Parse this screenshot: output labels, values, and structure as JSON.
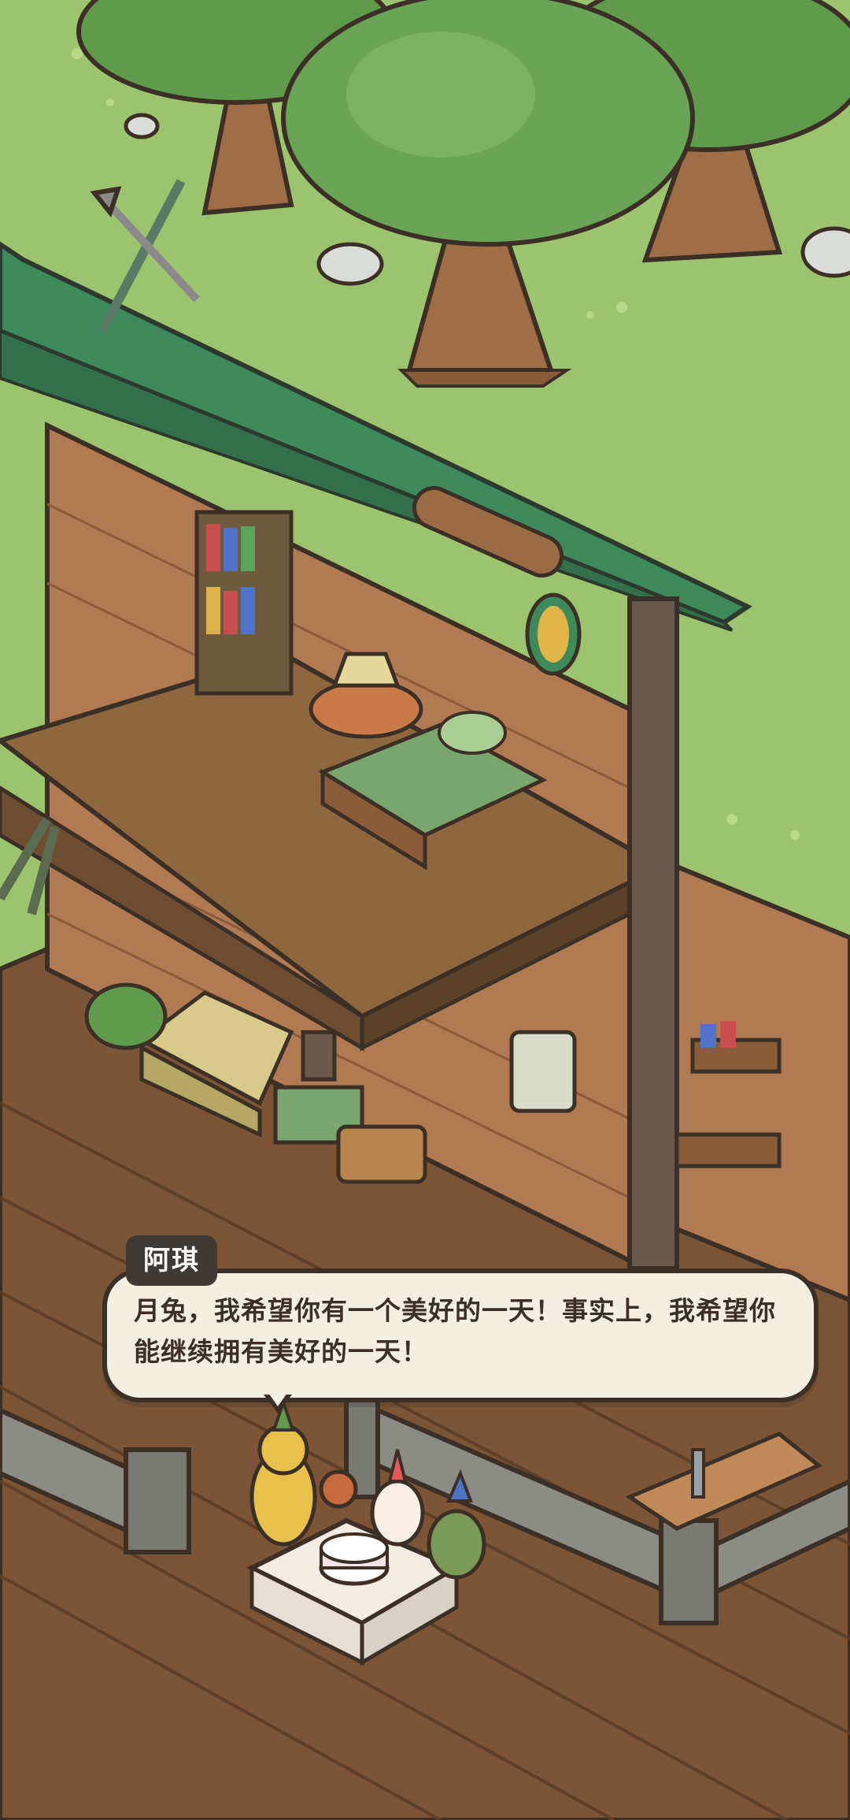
{
  "scene": {
    "description_icon": "treehouse-birthday-scene",
    "colors": {
      "grass": "#9cc46e",
      "roof": "#3f8a5a",
      "brick": "#b07a52",
      "floor": "#8a623e",
      "bubble_bg": "#f4f0df",
      "bubble_border": "#3b2f26",
      "name_tag_bg": "#3f3a35"
    }
  },
  "dialog": {
    "speaker": "阿琪",
    "text": "月兔，我希望你有一个美好的一天！事实上，我希望你能继续拥有美好的一天！"
  }
}
